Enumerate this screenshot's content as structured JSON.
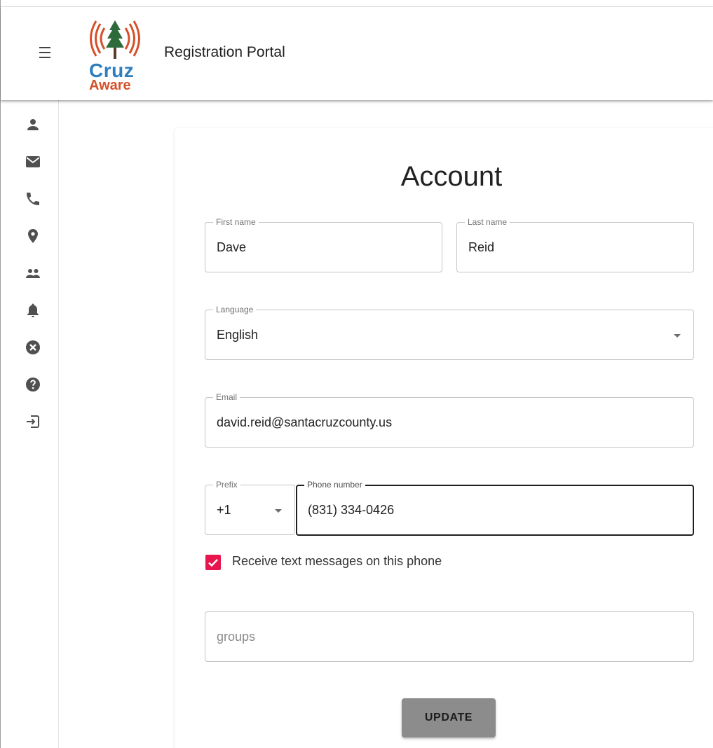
{
  "header": {
    "title": "Registration Portal",
    "logo": {
      "line1": "Cruz",
      "line2": "Aware",
      "colors": {
        "blue": "#2f7fbf",
        "orange": "#d5512a",
        "green": "#2e6b3a"
      }
    },
    "menu_icon": "menu-icon"
  },
  "sidebar": {
    "items": [
      {
        "icon": "person-icon"
      },
      {
        "icon": "mail-icon"
      },
      {
        "icon": "phone-icon"
      },
      {
        "icon": "location-pin-icon"
      },
      {
        "icon": "people-icon"
      },
      {
        "icon": "bell-icon"
      },
      {
        "icon": "cancel-circle-icon"
      },
      {
        "icon": "help-circle-icon"
      },
      {
        "icon": "logout-icon"
      }
    ]
  },
  "account": {
    "title": "Account",
    "first_name": {
      "label": "First name",
      "value": "Dave"
    },
    "last_name": {
      "label": "Last name",
      "value": "Reid"
    },
    "language": {
      "label": "Language",
      "value": "English"
    },
    "email": {
      "label": "Email",
      "value": "david.reid@santacruzcounty.us"
    },
    "prefix": {
      "label": "Prefix",
      "value": "+1"
    },
    "phone": {
      "label": "Phone number",
      "value": "(831) 334-0426"
    },
    "sms_checkbox": {
      "label": "Receive text messages on this phone",
      "checked": true
    },
    "groups": {
      "placeholder": "groups"
    },
    "update_button": "UPDATE"
  },
  "colors": {
    "checkbox": "#e8164f",
    "button": "#8c8c8c",
    "sidebar_icon": "#505050"
  }
}
